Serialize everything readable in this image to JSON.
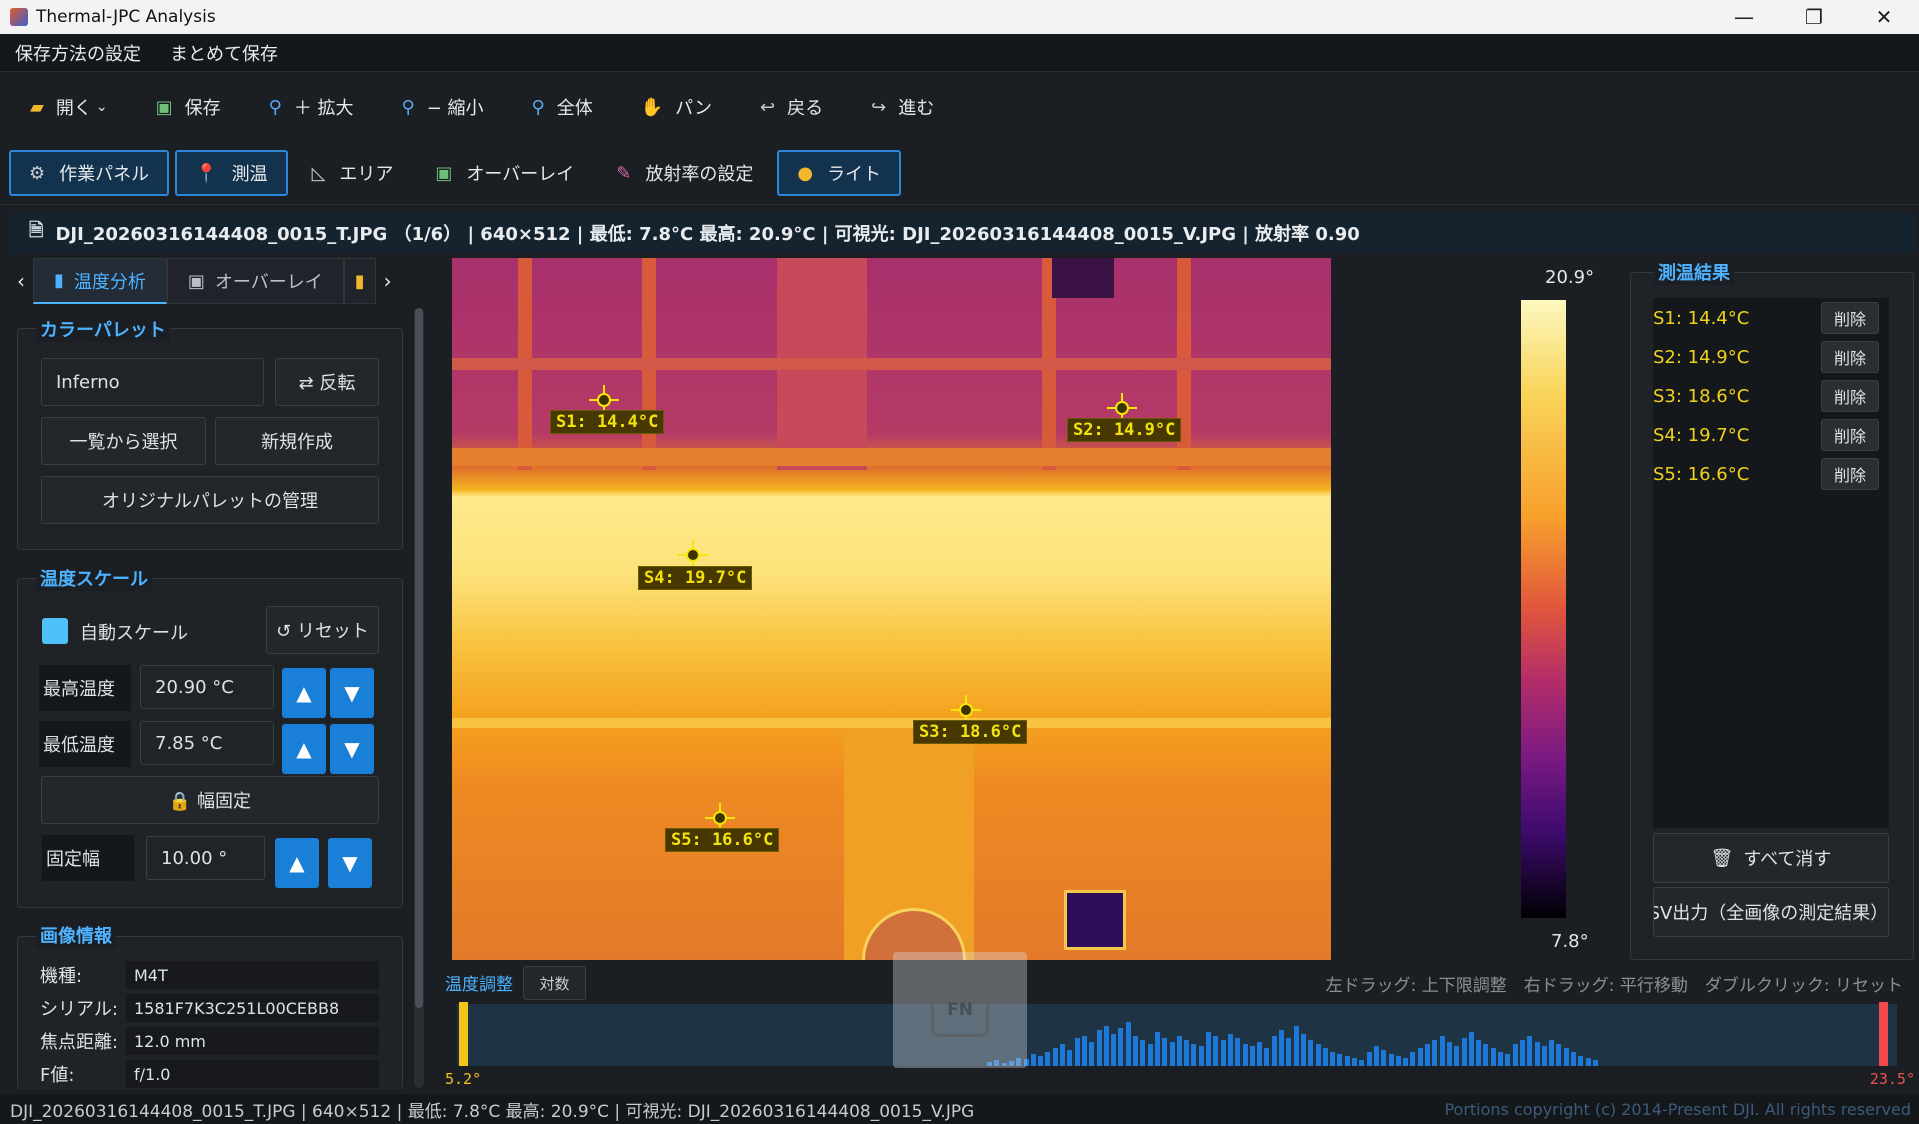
{
  "window": {
    "title": "Thermal-JPC Analysis",
    "minimize": "—",
    "maximize": "❐",
    "close": "✕"
  },
  "menu": [
    "保存方法の設定",
    "まとめて保存"
  ],
  "toolbar": {
    "open": "開く",
    "save": "保存",
    "zoom_in": "＋ 拡大",
    "zoom_out": "− 縮小",
    "fit": "全体",
    "pan": "パン",
    "back": "戻る",
    "forward": "進む"
  },
  "modes": {
    "panel": "作業パネル",
    "measure": "測温",
    "area": "エリア",
    "overlay": "オーバーレイ",
    "emissivity": "放射率の設定",
    "light": "ライト"
  },
  "info_line": "DJI_20260316144408_0015_T.JPG （1/6） | 640×512 | 最低: 7.8°C 最高: 20.9°C | 可視光: DJI_20260316144408_0015_V.JPG | 放射率 0.90",
  "side_tabs": {
    "analysis": "温度分析",
    "overlay": "オーバーレイ"
  },
  "palette": {
    "title": "カラーパレット",
    "current": "Inferno",
    "invert": "⇄ 反転",
    "select": "一覧から選択",
    "create": "新規作成",
    "manage": "オリジナルパレットの管理"
  },
  "scale": {
    "title": "温度スケール",
    "auto": "自動スケール",
    "reset": "↺ リセット",
    "max_label": "最高温度",
    "max_value": "20.90 °C",
    "min_label": "最低温度",
    "min_value": "7.85 °C",
    "lock": "🔒 幅固定",
    "width_label": "固定幅",
    "width_value": "10.00 °",
    "up": "▲",
    "down": "▼"
  },
  "image_info": {
    "title": "画像情報",
    "rows": [
      {
        "k": "機種:",
        "v": "M4T"
      },
      {
        "k": "シリアル:",
        "v": "1581F7K3C251L00CEBB8"
      },
      {
        "k": "焦点距離:",
        "v": "12.0 mm"
      },
      {
        "k": "F値:",
        "v": "f/1.0"
      }
    ]
  },
  "spots": [
    {
      "label": "S1: 14.4°C"
    },
    {
      "label": "S2: 14.9°C"
    },
    {
      "label": "S3: 18.6°C"
    },
    {
      "label": "S4: 19.7°C"
    },
    {
      "label": "S5: 16.6°C"
    }
  ],
  "colorbar": {
    "max": "20.9°",
    "min": "7.8°"
  },
  "results": {
    "title": "測温結果",
    "delete": "削除",
    "items": [
      "S1: 14.4°C",
      "S2: 14.9°C",
      "S3: 18.6°C",
      "S4: 19.7°C",
      "S5: 16.6°C"
    ],
    "clear_all": "すべて消す",
    "export": "CSV出力（全画像の測定結果）"
  },
  "histogram": {
    "label": "温度調整",
    "log": "対数",
    "hint": "左ドラッグ: 上下限調整　右ドラッグ: 平行移動　ダブルクリック: リセット",
    "min": "5.2°",
    "max": "23.5°"
  },
  "fn_key": "FN",
  "status": {
    "text": "DJI_20260316144408_0015_T.JPG | 640×512 | 最低: 7.8°C 最高: 20.9°C | 可視光: DJI_20260316144408_0015_V.JPG",
    "copyright": "Portions copyright (c) 2014-Present DJI. All rights reserved"
  }
}
